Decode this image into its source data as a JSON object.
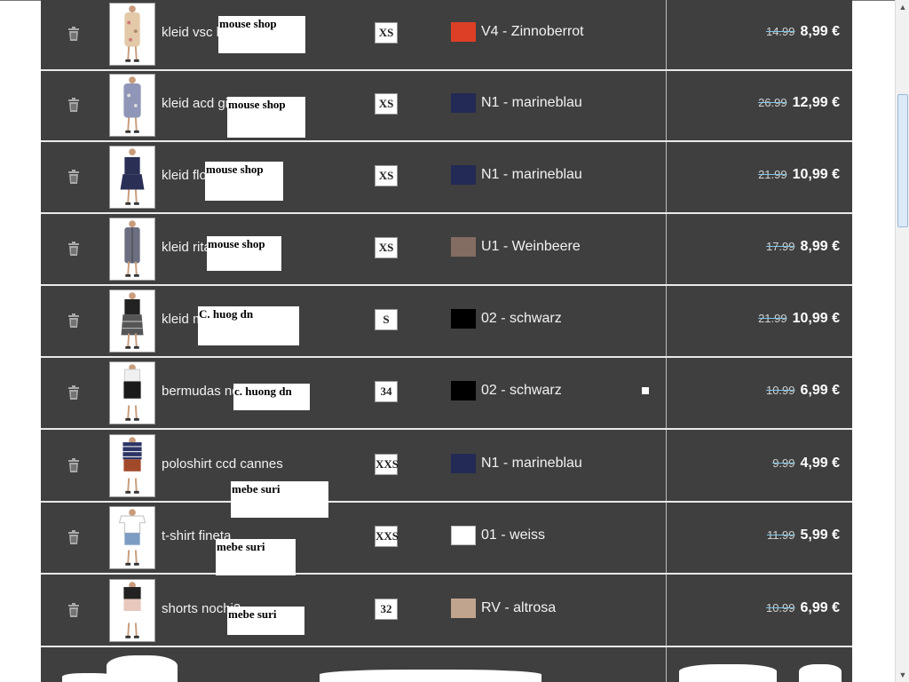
{
  "icons": {
    "delete": "trash-icon",
    "scroll_up": "scroll-up-arrow-icon",
    "scroll_down": "scroll-down-arrow-icon"
  },
  "colors": {
    "panel": "#3f3f3f",
    "strike": "#7fc6e6"
  },
  "items": [
    {
      "name": "kleid vsc lima",
      "note": "mouse shop",
      "size": "XS",
      "swatch": "#dd3f26",
      "color_name": "V4 - Zinnoberrot",
      "old_price": "14.99",
      "new_price": "8,99 €",
      "thumb": "floral-dress"
    },
    {
      "name": "kleid acd gina",
      "note": "mouse shop",
      "size": "XS",
      "swatch": "#232a55",
      "color_name": "N1 - marineblau",
      "old_price": "26.99",
      "new_price": "12,99 €",
      "thumb": "print-dress"
    },
    {
      "name": "kleid flora",
      "note": "mouse shop",
      "size": "XS",
      "swatch": "#232a55",
      "color_name": "N1 - marineblau",
      "old_price": "21.99",
      "new_price": "10,99 €",
      "thumb": "navy-dress"
    },
    {
      "name": "kleid rita",
      "note": "mouse shop",
      "size": "XS",
      "swatch": "#836c62",
      "color_name": "U1 - Weinbeere",
      "old_price": "17.99",
      "new_price": "8,99 €",
      "thumb": "shirt-dress"
    },
    {
      "name": "kleid max",
      "note": "C. huog dn",
      "size": "S",
      "swatch": "#000000",
      "color_name": "02 - schwarz",
      "old_price": "21.99",
      "new_price": "10,99 €",
      "thumb": "lace-dress"
    },
    {
      "name": "bermudas nochi",
      "note": "c. huong dn",
      "size": "34",
      "swatch": "#000000",
      "color_name": "02 - schwarz",
      "old_price": "10.99",
      "new_price": "6,99 €",
      "thumb": "bermudas"
    },
    {
      "name": "poloshirt ccd cannes",
      "note": "mebe suri",
      "size": "XXS",
      "swatch": "#232a55",
      "color_name": "N1 - marineblau",
      "old_price": "9.99",
      "new_price": "4,99 €",
      "thumb": "polo"
    },
    {
      "name": "t-shirt fineta",
      "note": "mebe suri",
      "size": "XXS",
      "swatch": "#ffffff",
      "color_name": "01 - weiss",
      "old_price": "11.99",
      "new_price": "5,99 €",
      "thumb": "tshirt"
    },
    {
      "name": "shorts nochi2",
      "note": "mebe suri",
      "size": "32",
      "swatch": "#c0a48e",
      "color_name": "RV - altrosa",
      "old_price": "10.99",
      "new_price": "6,99 €",
      "thumb": "pink-shorts"
    }
  ]
}
